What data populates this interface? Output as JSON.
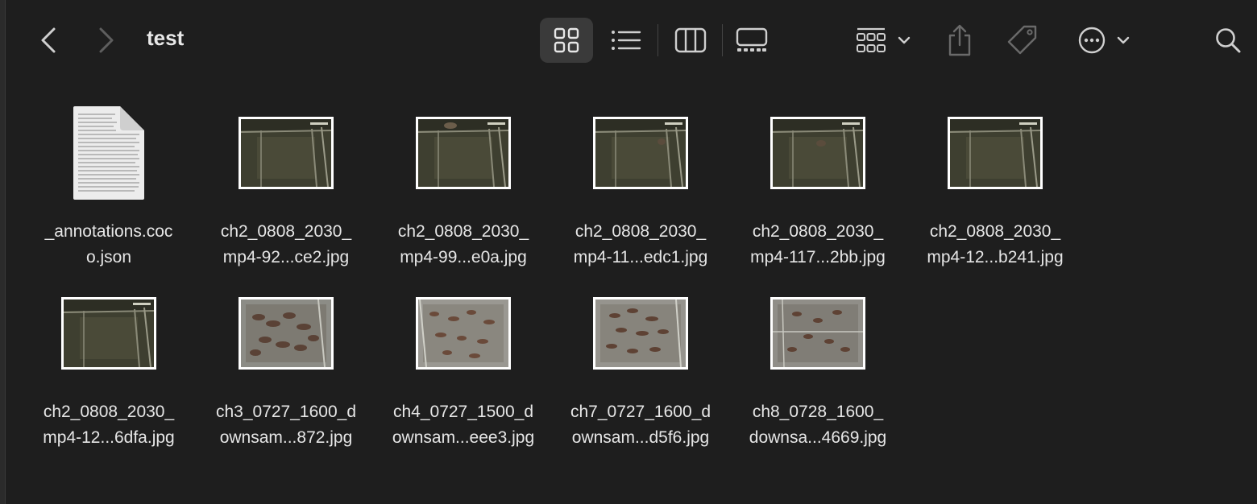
{
  "toolbar": {
    "title": "test",
    "icons": {
      "back": "chevron-left-icon",
      "forward": "chevron-right-icon",
      "icon_view": "icon-view-grid-icon",
      "list_view": "list-view-icon",
      "column_view": "column-view-icon",
      "gallery_view": "gallery-view-icon",
      "group": "group-items-icon",
      "share": "share-icon",
      "tag": "tag-icon",
      "more": "ellipsis-circle-icon",
      "search": "search-icon"
    },
    "selected_view": "icon"
  },
  "files": [
    {
      "line1": "_annotations.coc",
      "line2": "o.json",
      "kind": "json",
      "scene": "doc"
    },
    {
      "line1": "ch2_0808_2030_",
      "line2": "mp4-92...ce2.jpg",
      "kind": "jpg",
      "scene": "pen"
    },
    {
      "line1": "ch2_0808_2030_",
      "line2": "mp4-99...e0a.jpg",
      "kind": "jpg",
      "scene": "pen"
    },
    {
      "line1": "ch2_0808_2030_",
      "line2": "mp4-11...edc1.jpg",
      "kind": "jpg",
      "scene": "pen"
    },
    {
      "line1": "ch2_0808_2030_",
      "line2": "mp4-117...2bb.jpg",
      "kind": "jpg",
      "scene": "pen"
    },
    {
      "line1": "ch2_0808_2030_",
      "line2": "mp4-12...b241.jpg",
      "kind": "jpg",
      "scene": "pen"
    },
    {
      "line1": "ch2_0808_2030_",
      "line2": "mp4-12...6dfa.jpg",
      "kind": "jpg",
      "scene": "pen"
    },
    {
      "line1": "ch3_0727_1600_d",
      "line2": "ownsam...872.jpg",
      "kind": "jpg",
      "scene": "herd"
    },
    {
      "line1": "ch4_0727_1500_d",
      "line2": "ownsam...eee3.jpg",
      "kind": "jpg",
      "scene": "herd"
    },
    {
      "line1": "ch7_0727_1600_d",
      "line2": "ownsam...d5f6.jpg",
      "kind": "jpg",
      "scene": "herd"
    },
    {
      "line1": "ch8_0728_1600_",
      "line2": "downsa...4669.jpg",
      "kind": "jpg",
      "scene": "herd"
    }
  ],
  "colors": {
    "background": "#1e1e1e",
    "text": "#e6e6e6",
    "icon": "#cfcfcf",
    "icon_dim": "#8a8a8a",
    "selected_bg": "#3a3a3a"
  }
}
